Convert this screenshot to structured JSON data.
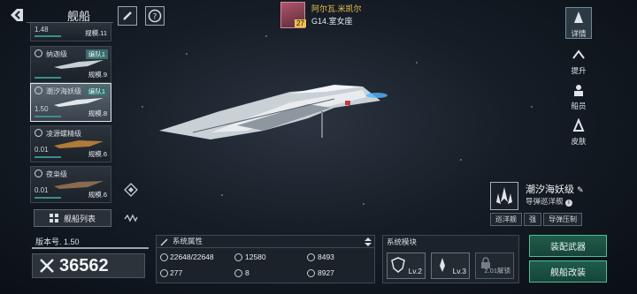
{
  "header": {
    "title": "舰船"
  },
  "captain": {
    "name": "阿尔瓦.米凯尔",
    "star": "G14.室女座",
    "level": "27"
  },
  "ship_list": [
    {
      "name": "",
      "level": "1.48",
      "scale": "规模.11",
      "fleet": ""
    },
    {
      "name": "纳迦级",
      "level": "",
      "scale": "规模.9",
      "fleet": "编队1"
    },
    {
      "name": "潮汐海妖级",
      "level": "1.50",
      "scale": "规模.8",
      "fleet": "编队1"
    },
    {
      "name": "凌源螺精级",
      "level": "0.01",
      "scale": "规模.6",
      "fleet": ""
    },
    {
      "name": "夜枭级",
      "level": "0.01",
      "scale": "规模.6",
      "fleet": ""
    }
  ],
  "list_button": "舰船列表",
  "version": "版本号. 1.50",
  "power": "36562",
  "attributes": {
    "title": "系统属性",
    "hp": "22648/22648",
    "armor": "12580",
    "attack": "8493",
    "speed": "277",
    "slots": "8",
    "defense": "8927"
  },
  "modules": {
    "title": "系统模块",
    "items": [
      {
        "level": "Lv.2"
      },
      {
        "level": "Lv.3"
      },
      {
        "level": "2.01解锁"
      }
    ]
  },
  "ship": {
    "name": "潮汐海妖级",
    "class": "导弹巡洋舰",
    "tags": [
      "巡洋舰",
      "强",
      "导弹压制"
    ]
  },
  "right_nav": [
    {
      "label": "详情",
      "icon": "detail-icon",
      "active": true
    },
    {
      "label": "提升",
      "icon": "upgrade-icon",
      "active": false
    },
    {
      "label": "船员",
      "icon": "crew-icon",
      "active": false
    },
    {
      "label": "皮肤",
      "icon": "skin-icon",
      "active": false
    }
  ],
  "buttons": {
    "equip": "装配武器",
    "refit": "舰船改装"
  },
  "colors": {
    "accent": "#4bbf97",
    "captain_name": "#f0c050",
    "selected": "#dfe7ee"
  }
}
